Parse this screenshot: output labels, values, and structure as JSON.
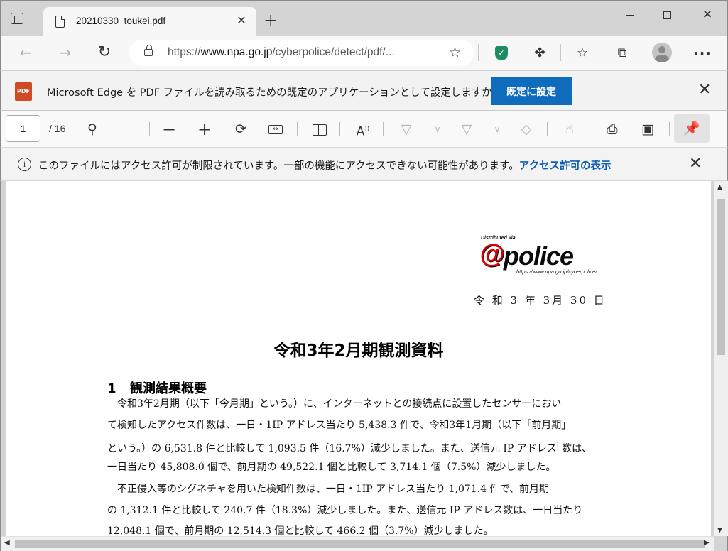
{
  "browser": {
    "tab_title": "20210330_toukei.pdf",
    "tab_close": "✕",
    "new_tab": "+",
    "window_min": "",
    "window_max": "",
    "window_close": "✕",
    "url_prefix": "https://",
    "url_host": "www.npa.go.jp",
    "url_path": "/cyberpolice/detect/pdf/..."
  },
  "banner": {
    "badge": "PDF",
    "message": "Microsoft Edge を PDF ファイルを読み取るための既定のアプリケーションとして設定しますか?",
    "button_label": "既定に設定",
    "close": "✕"
  },
  "pdf_toolbar": {
    "page_current": "1",
    "page_total": "/ 16"
  },
  "infobar": {
    "message": "このファイルにはアクセス許可が制限されています。一部の機能にアクセスできない可能性があります。",
    "link": "アクセス許可の表示",
    "close": "✕"
  },
  "document": {
    "logo_distributed": "Distributed via",
    "logo_at": "@",
    "logo_word": "police",
    "logo_url": "https://www.npa.go.jp/cyberpolice/",
    "date": "令 和 3 年 3月 30 日",
    "title": "令和3年2月期観測資料",
    "section_number": "1",
    "section_title": "観測結果概要",
    "para1": [
      "令和3年2月期（以下「今月期」という。）に、インターネットとの接続点に設置したセンサーにおい",
      "て検知したアクセス件数は、一日・1IP アドレス当たり 5,438.3 件で、令和3年1月期（以下「前月期」",
      "という。）の 6,531.8 件と比較して 1,093.5 件（16.7%）減少しました。また、送信元 IP アドレス",
      "一日当たり 45,808.0 個で、前月期の 49,522.1 個と比較して 3,714.1 個（7.5%）減少しました。"
    ],
    "para1_line3_suffix": "数は、",
    "footnote_mark": "i",
    "para2": [
      "不正侵入等のシグネチャを用いた検知件数は、一日・1IP アドレス当たり 1,071.4 件で、前月期",
      "の 1,312.1 件と比較して 240.7 件（18.3%）減少しました。また、送信元 IP アドレス数は、一日当たり",
      "12,048.1 個で、前月期の 12,514.3 個と比較して 466.2 個（3.7%）減少しました。"
    ]
  }
}
